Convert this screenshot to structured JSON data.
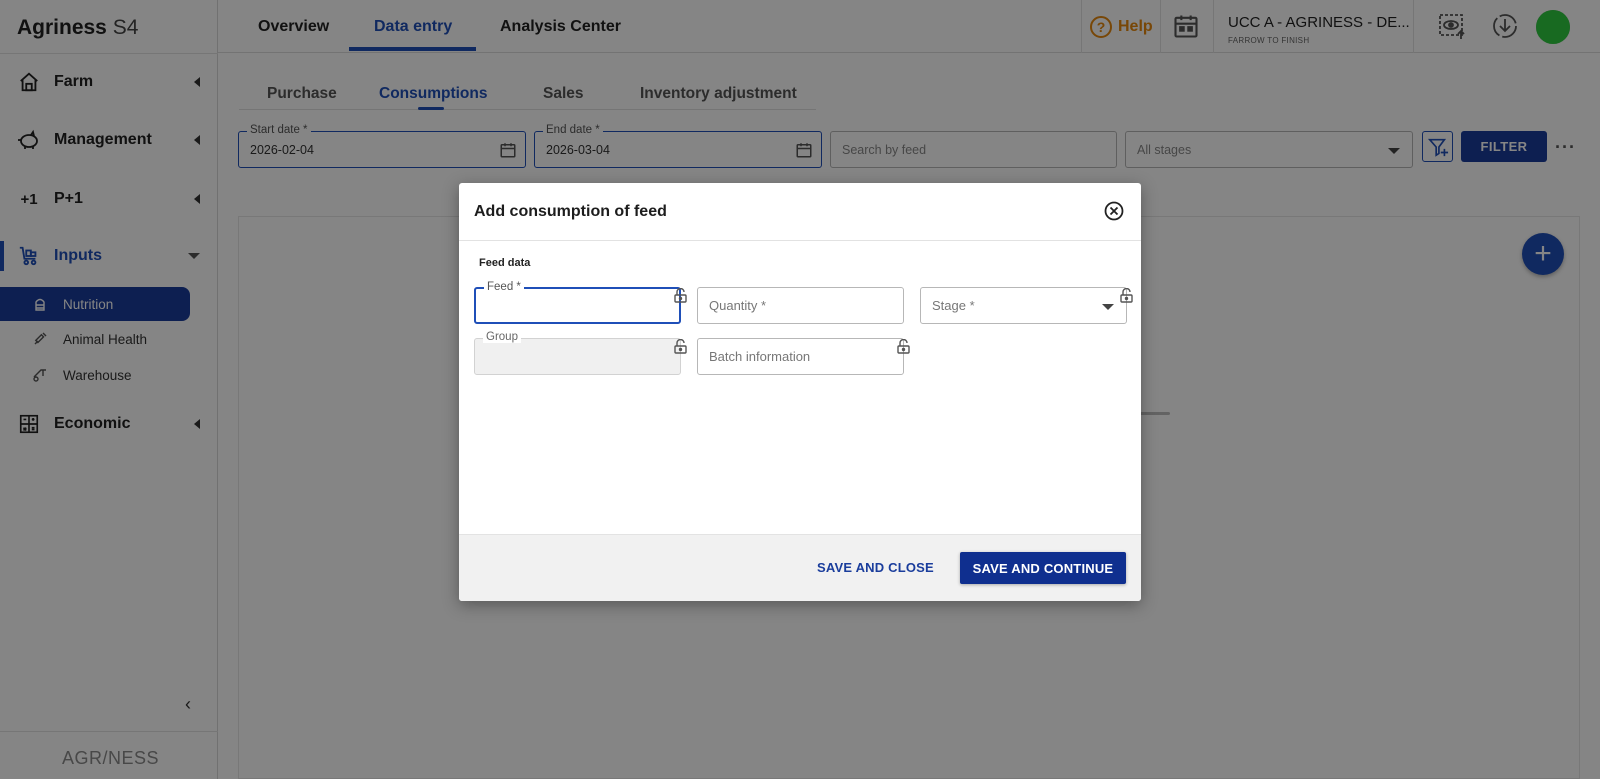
{
  "brand": {
    "name": "Agriness",
    "suffix": "S4"
  },
  "sidebar": {
    "items": [
      {
        "label": "Farm",
        "icon": "home-icon"
      },
      {
        "label": "Management",
        "icon": "pig-icon"
      },
      {
        "label": "P+1",
        "icon": "plus-one-icon"
      },
      {
        "label": "Inputs",
        "icon": "cart-icon"
      },
      {
        "label": "Economic",
        "icon": "calculator-icon"
      }
    ],
    "subitems": [
      {
        "label": "Nutrition",
        "icon": "silo-icon"
      },
      {
        "label": "Animal Health",
        "icon": "syringe-icon"
      },
      {
        "label": "Warehouse",
        "icon": "forklift-icon"
      }
    ],
    "footer_logo": "AGR/NESS"
  },
  "topbar": {
    "tabs": [
      "Overview",
      "Data entry",
      "Analysis Center"
    ],
    "help": "Help",
    "farm_name": "UCC A - AGRINESS - DE...",
    "farm_type": "FARROW TO FINISH"
  },
  "subtabs": [
    "Purchase",
    "Consumptions",
    "Sales",
    "Inventory adjustment"
  ],
  "filters": {
    "start_label": "Start date *",
    "start_value": "2026-02-04",
    "end_label": "End date *",
    "end_value": "2026-03-04",
    "search_placeholder": "Search by feed",
    "stages_value": "All stages",
    "filter_button": "FILTER"
  },
  "dialog": {
    "title": "Add consumption of feed",
    "section": "Feed data",
    "feed_label": "Feed *",
    "quantity_placeholder": "Quantity *",
    "stage_placeholder": "Stage *",
    "group_label": "Group",
    "batch_placeholder": "Batch information",
    "save_close": "SAVE AND CLOSE",
    "save_continue": "SAVE AND CONTINUE"
  },
  "colors": {
    "primary": "#1a3d9c",
    "accent": "#1f4fb8",
    "help": "#e6890f"
  }
}
